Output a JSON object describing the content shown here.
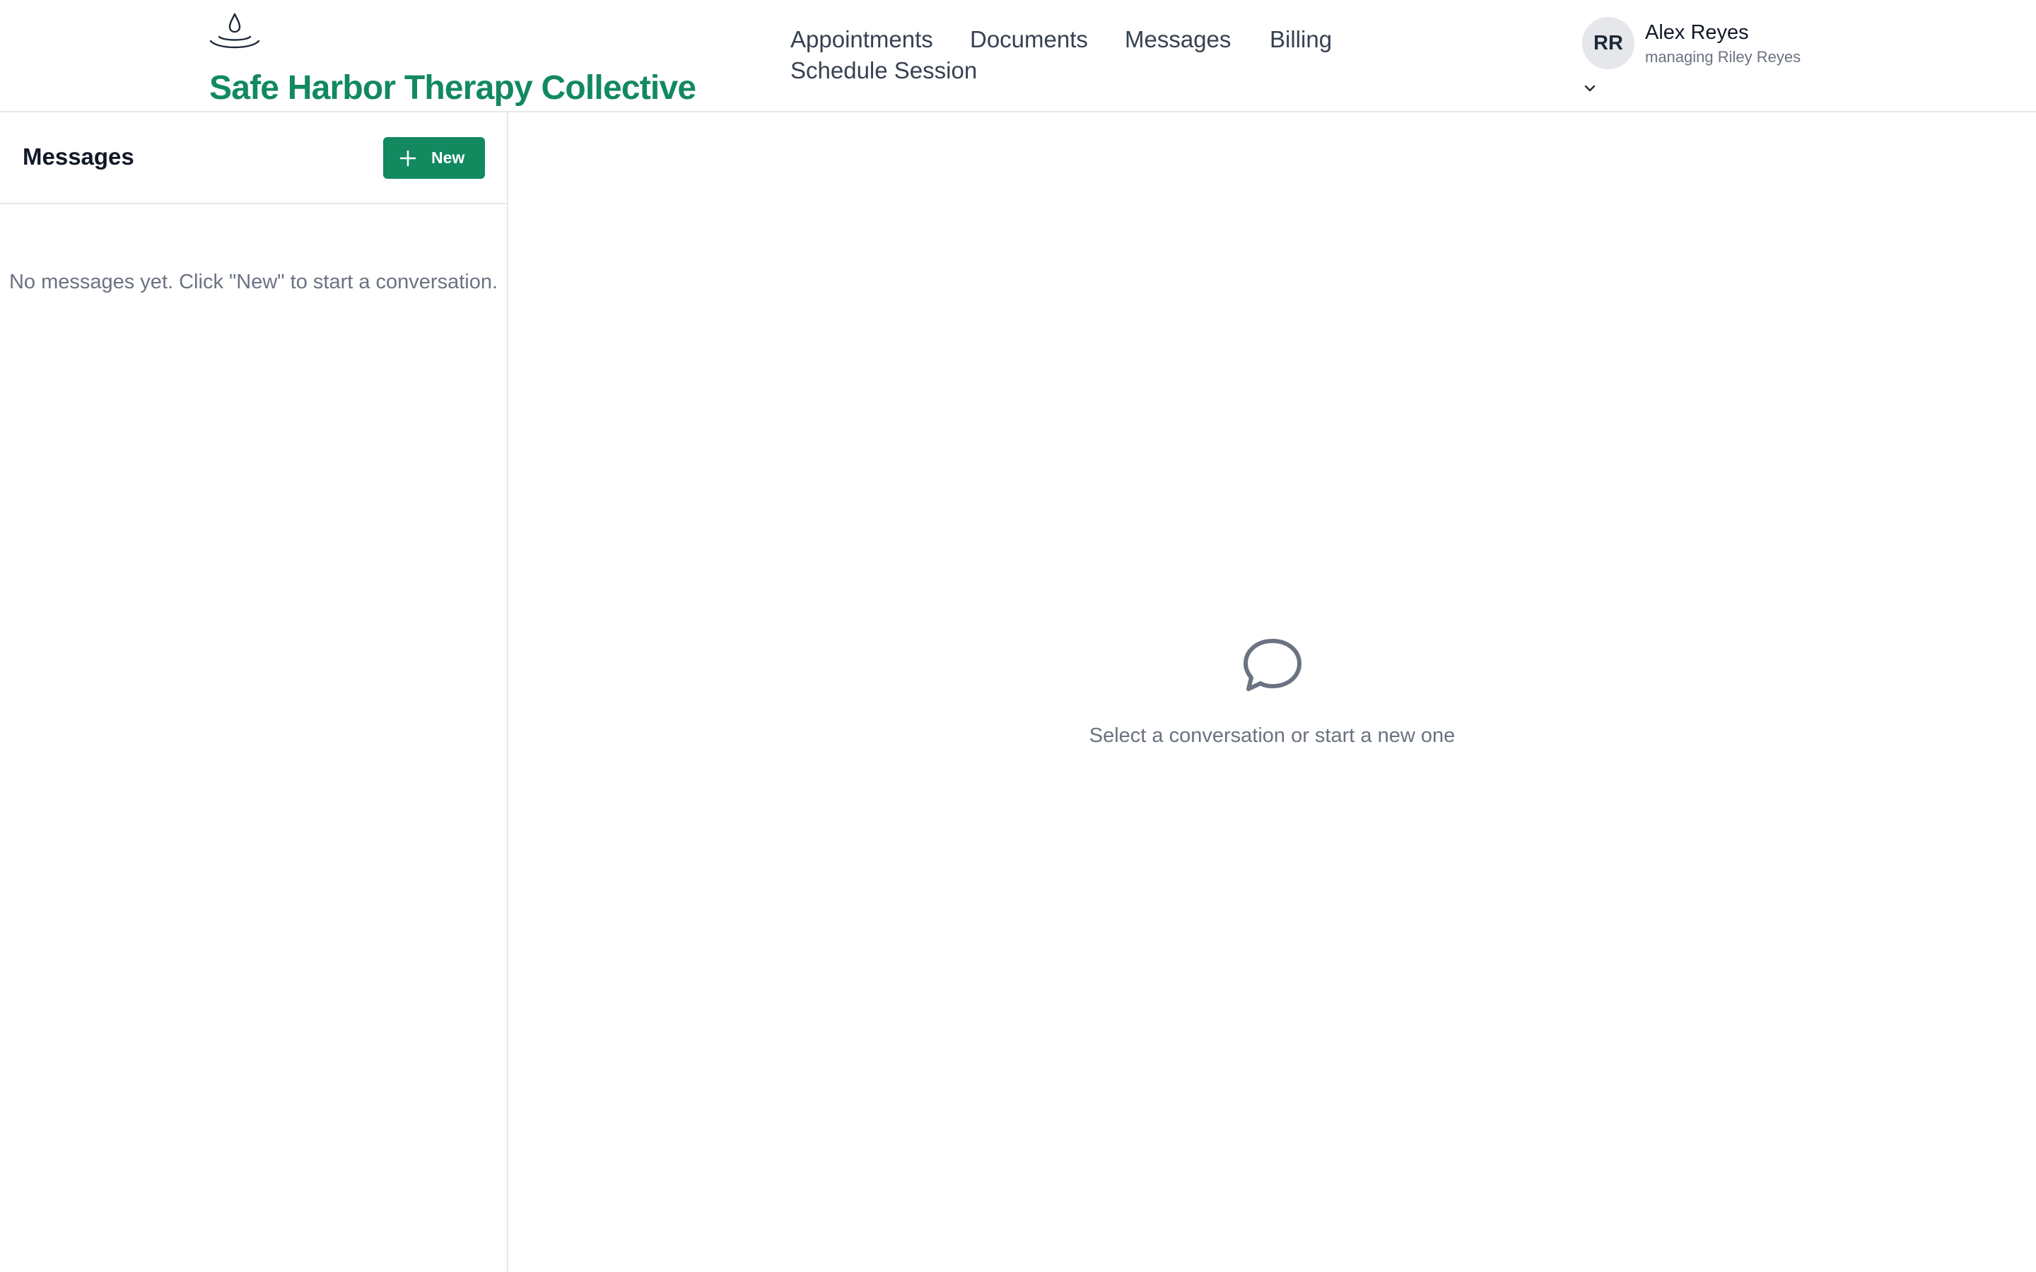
{
  "brand": {
    "name": "Safe Harbor Therapy Collective",
    "logo_icon": "water-drop-ripple-icon",
    "color": "#12895f"
  },
  "nav": {
    "items": [
      {
        "label": "Appointments"
      },
      {
        "label": "Documents"
      },
      {
        "label": "Messages"
      },
      {
        "label": "Billing"
      },
      {
        "label": "Schedule Session"
      }
    ]
  },
  "user": {
    "initials": "RR",
    "name": "Alex Reyes",
    "subtitle": "managing Riley Reyes",
    "menu_icon": "chevron-down-icon"
  },
  "sidebar": {
    "title": "Messages",
    "new_button": {
      "label": "New",
      "icon": "plus-icon"
    },
    "empty_text": "No messages yet. Click \"New\" to start a conversation."
  },
  "main": {
    "empty_icon": "chat-bubble-icon",
    "empty_text": "Select a conversation or start a new one"
  }
}
